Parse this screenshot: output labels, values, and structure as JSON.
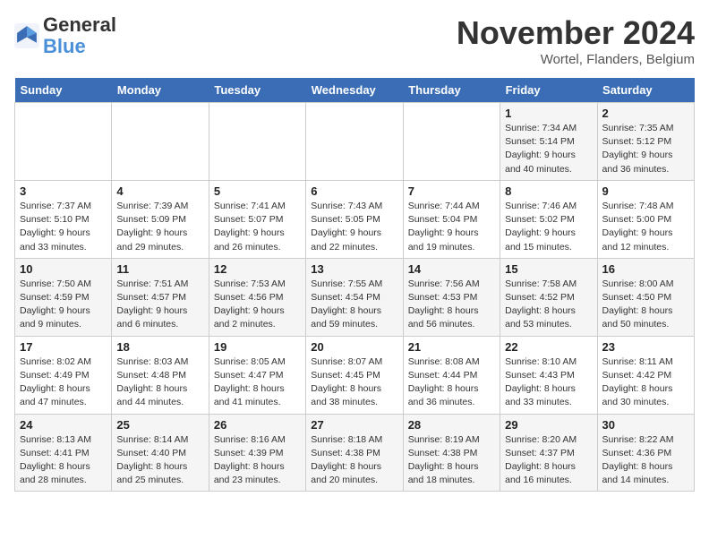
{
  "header": {
    "logo_line1": "General",
    "logo_line2": "Blue",
    "month_title": "November 2024",
    "location": "Wortel, Flanders, Belgium"
  },
  "weekdays": [
    "Sunday",
    "Monday",
    "Tuesday",
    "Wednesday",
    "Thursday",
    "Friday",
    "Saturday"
  ],
  "weeks": [
    [
      {
        "day": "",
        "info": ""
      },
      {
        "day": "",
        "info": ""
      },
      {
        "day": "",
        "info": ""
      },
      {
        "day": "",
        "info": ""
      },
      {
        "day": "",
        "info": ""
      },
      {
        "day": "1",
        "info": "Sunrise: 7:34 AM\nSunset: 5:14 PM\nDaylight: 9 hours and 40 minutes."
      },
      {
        "day": "2",
        "info": "Sunrise: 7:35 AM\nSunset: 5:12 PM\nDaylight: 9 hours and 36 minutes."
      }
    ],
    [
      {
        "day": "3",
        "info": "Sunrise: 7:37 AM\nSunset: 5:10 PM\nDaylight: 9 hours and 33 minutes."
      },
      {
        "day": "4",
        "info": "Sunrise: 7:39 AM\nSunset: 5:09 PM\nDaylight: 9 hours and 29 minutes."
      },
      {
        "day": "5",
        "info": "Sunrise: 7:41 AM\nSunset: 5:07 PM\nDaylight: 9 hours and 26 minutes."
      },
      {
        "day": "6",
        "info": "Sunrise: 7:43 AM\nSunset: 5:05 PM\nDaylight: 9 hours and 22 minutes."
      },
      {
        "day": "7",
        "info": "Sunrise: 7:44 AM\nSunset: 5:04 PM\nDaylight: 9 hours and 19 minutes."
      },
      {
        "day": "8",
        "info": "Sunrise: 7:46 AM\nSunset: 5:02 PM\nDaylight: 9 hours and 15 minutes."
      },
      {
        "day": "9",
        "info": "Sunrise: 7:48 AM\nSunset: 5:00 PM\nDaylight: 9 hours and 12 minutes."
      }
    ],
    [
      {
        "day": "10",
        "info": "Sunrise: 7:50 AM\nSunset: 4:59 PM\nDaylight: 9 hours and 9 minutes."
      },
      {
        "day": "11",
        "info": "Sunrise: 7:51 AM\nSunset: 4:57 PM\nDaylight: 9 hours and 6 minutes."
      },
      {
        "day": "12",
        "info": "Sunrise: 7:53 AM\nSunset: 4:56 PM\nDaylight: 9 hours and 2 minutes."
      },
      {
        "day": "13",
        "info": "Sunrise: 7:55 AM\nSunset: 4:54 PM\nDaylight: 8 hours and 59 minutes."
      },
      {
        "day": "14",
        "info": "Sunrise: 7:56 AM\nSunset: 4:53 PM\nDaylight: 8 hours and 56 minutes."
      },
      {
        "day": "15",
        "info": "Sunrise: 7:58 AM\nSunset: 4:52 PM\nDaylight: 8 hours and 53 minutes."
      },
      {
        "day": "16",
        "info": "Sunrise: 8:00 AM\nSunset: 4:50 PM\nDaylight: 8 hours and 50 minutes."
      }
    ],
    [
      {
        "day": "17",
        "info": "Sunrise: 8:02 AM\nSunset: 4:49 PM\nDaylight: 8 hours and 47 minutes."
      },
      {
        "day": "18",
        "info": "Sunrise: 8:03 AM\nSunset: 4:48 PM\nDaylight: 8 hours and 44 minutes."
      },
      {
        "day": "19",
        "info": "Sunrise: 8:05 AM\nSunset: 4:47 PM\nDaylight: 8 hours and 41 minutes."
      },
      {
        "day": "20",
        "info": "Sunrise: 8:07 AM\nSunset: 4:45 PM\nDaylight: 8 hours and 38 minutes."
      },
      {
        "day": "21",
        "info": "Sunrise: 8:08 AM\nSunset: 4:44 PM\nDaylight: 8 hours and 36 minutes."
      },
      {
        "day": "22",
        "info": "Sunrise: 8:10 AM\nSunset: 4:43 PM\nDaylight: 8 hours and 33 minutes."
      },
      {
        "day": "23",
        "info": "Sunrise: 8:11 AM\nSunset: 4:42 PM\nDaylight: 8 hours and 30 minutes."
      }
    ],
    [
      {
        "day": "24",
        "info": "Sunrise: 8:13 AM\nSunset: 4:41 PM\nDaylight: 8 hours and 28 minutes."
      },
      {
        "day": "25",
        "info": "Sunrise: 8:14 AM\nSunset: 4:40 PM\nDaylight: 8 hours and 25 minutes."
      },
      {
        "day": "26",
        "info": "Sunrise: 8:16 AM\nSunset: 4:39 PM\nDaylight: 8 hours and 23 minutes."
      },
      {
        "day": "27",
        "info": "Sunrise: 8:18 AM\nSunset: 4:38 PM\nDaylight: 8 hours and 20 minutes."
      },
      {
        "day": "28",
        "info": "Sunrise: 8:19 AM\nSunset: 4:38 PM\nDaylight: 8 hours and 18 minutes."
      },
      {
        "day": "29",
        "info": "Sunrise: 8:20 AM\nSunset: 4:37 PM\nDaylight: 8 hours and 16 minutes."
      },
      {
        "day": "30",
        "info": "Sunrise: 8:22 AM\nSunset: 4:36 PM\nDaylight: 8 hours and 14 minutes."
      }
    ]
  ]
}
